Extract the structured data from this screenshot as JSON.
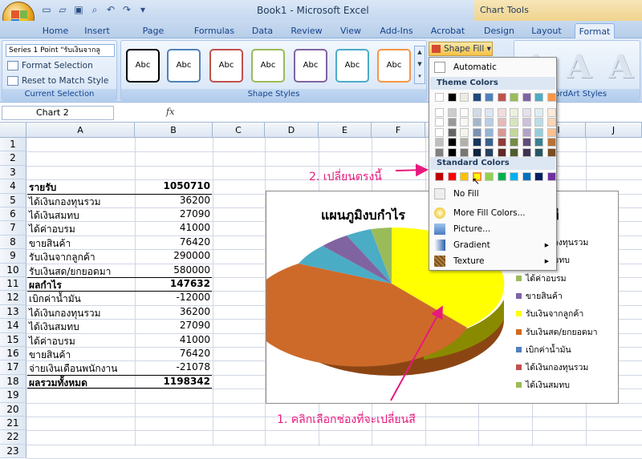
{
  "window": {
    "title": "Book1 - Microsoft Excel",
    "context_title": "Chart Tools"
  },
  "tabs": [
    "Home",
    "Insert",
    "Page Layout",
    "Formulas",
    "Data",
    "Review",
    "View",
    "Add-Ins",
    "Acrobat",
    "Design",
    "Layout",
    "Format"
  ],
  "active_tab": "Format",
  "ribbon": {
    "selection_dropdown": "Series 1 Point \"รับเงินจากลู",
    "format_selection": "Format Selection",
    "reset_to_match": "Reset to Match Style",
    "current_selection_label": "Current Selection",
    "shape_style_sample": "Abc",
    "shape_styles_label": "Shape Styles",
    "shape_fill": "Shape Fill",
    "wordart_label": "WordArt Styles",
    "shape_style_colors": [
      "#000000",
      "#4f81bd",
      "#c0504d",
      "#9bbb59",
      "#8064a2",
      "#4bacc6",
      "#f79646"
    ]
  },
  "formula_bar": {
    "name_box": "Chart 2",
    "fx": "fx"
  },
  "columns": [
    "A",
    "B",
    "C",
    "D",
    "E",
    "F",
    "G",
    "H",
    "I",
    "J"
  ],
  "rows": [
    "1",
    "2",
    "3",
    "4",
    "5",
    "6",
    "7",
    "8",
    "9",
    "10",
    "11",
    "12",
    "13",
    "14",
    "15",
    "16",
    "17",
    "18",
    "19",
    "20",
    "21",
    "22",
    "23"
  ],
  "cells": [
    {
      "row": 4,
      "a": "รายรับ",
      "b": "1050710",
      "bold": true
    },
    {
      "row": 5,
      "a": "ได้เงินกองทุนรวม",
      "b": "36200"
    },
    {
      "row": 6,
      "a": "ได้เงินสมทบ",
      "b": "27090"
    },
    {
      "row": 7,
      "a": "ได้ค่าอบรม",
      "b": "41000"
    },
    {
      "row": 8,
      "a": "ขายสินค้า",
      "b": "76420"
    },
    {
      "row": 9,
      "a": "รับเงินจากลูกค้า",
      "b": "290000"
    },
    {
      "row": 10,
      "a": "รับเงินสด/ยกยอดมา",
      "b": "580000"
    },
    {
      "row": 11,
      "a": "ผลกำไร",
      "b": "147632",
      "bold": true
    },
    {
      "row": 12,
      "a": "เบิกค่าน้ำมัน",
      "b": "-12000"
    },
    {
      "row": 13,
      "a": "ได้เงินกองทุนรวม",
      "b": "36200"
    },
    {
      "row": 14,
      "a": "ได้เงินสมทบ",
      "b": "27090"
    },
    {
      "row": 15,
      "a": "ได้ค่าอบรม",
      "b": "41000"
    },
    {
      "row": 16,
      "a": "ขายสินค้า",
      "b": "76420"
    },
    {
      "row": 17,
      "a": "จ่ายเงินเดือนพนักงาน",
      "b": "-21078"
    },
    {
      "row": 18,
      "a": "ผลรวมทั้งหมด",
      "b": "1198342",
      "bold": true
    }
  ],
  "chart": {
    "title_left": "แผนภูมิงบกำไร",
    "title_right": "ที",
    "legend": [
      {
        "label": "ได้เงินกองทุนรวม",
        "color": "#4bacc6"
      },
      {
        "label": "ได้เงินสมทบ",
        "color": "#4f81bd"
      },
      {
        "label": "ได้ค่าอบรม",
        "color": "#9bbb59"
      },
      {
        "label": "ขายสินค้า",
        "color": "#8064a2"
      },
      {
        "label": "รับเงินจากลูกค้า",
        "color": "#ffff00"
      },
      {
        "label": "รับเงินสด/ยกยอดมา",
        "color": "#d2691e"
      },
      {
        "label": "เบิกค่าน้ำมัน",
        "color": "#4f81bd"
      },
      {
        "label": "ได้เงินกองทุนรวม",
        "color": "#c0504d"
      },
      {
        "label": "ได้เงินสมทบ",
        "color": "#9bbb59"
      }
    ]
  },
  "menu": {
    "automatic": "Automatic",
    "theme_colors": "Theme Colors",
    "standard_colors": "Standard Colors",
    "no_fill": "No Fill",
    "more_fill": "More Fill Colors...",
    "picture": "Picture...",
    "gradient": "Gradient",
    "texture": "Texture",
    "theme_top": [
      "#ffffff",
      "#000000",
      "#eeece1",
      "#1f497d",
      "#4f81bd",
      "#c0504d",
      "#9bbb59",
      "#8064a2",
      "#4bacc6",
      "#f79646"
    ],
    "standard": [
      "#c00000",
      "#ff0000",
      "#ffc000",
      "#ffff00",
      "#92d050",
      "#00b050",
      "#00b0f0",
      "#0070c0",
      "#002060",
      "#7030a0"
    ]
  },
  "annotations": {
    "step2": "2. เปลี่ยนตรงนี้",
    "step1": "1. คลิกเลือกช่องที่จะเปลี่ยนสี"
  }
}
